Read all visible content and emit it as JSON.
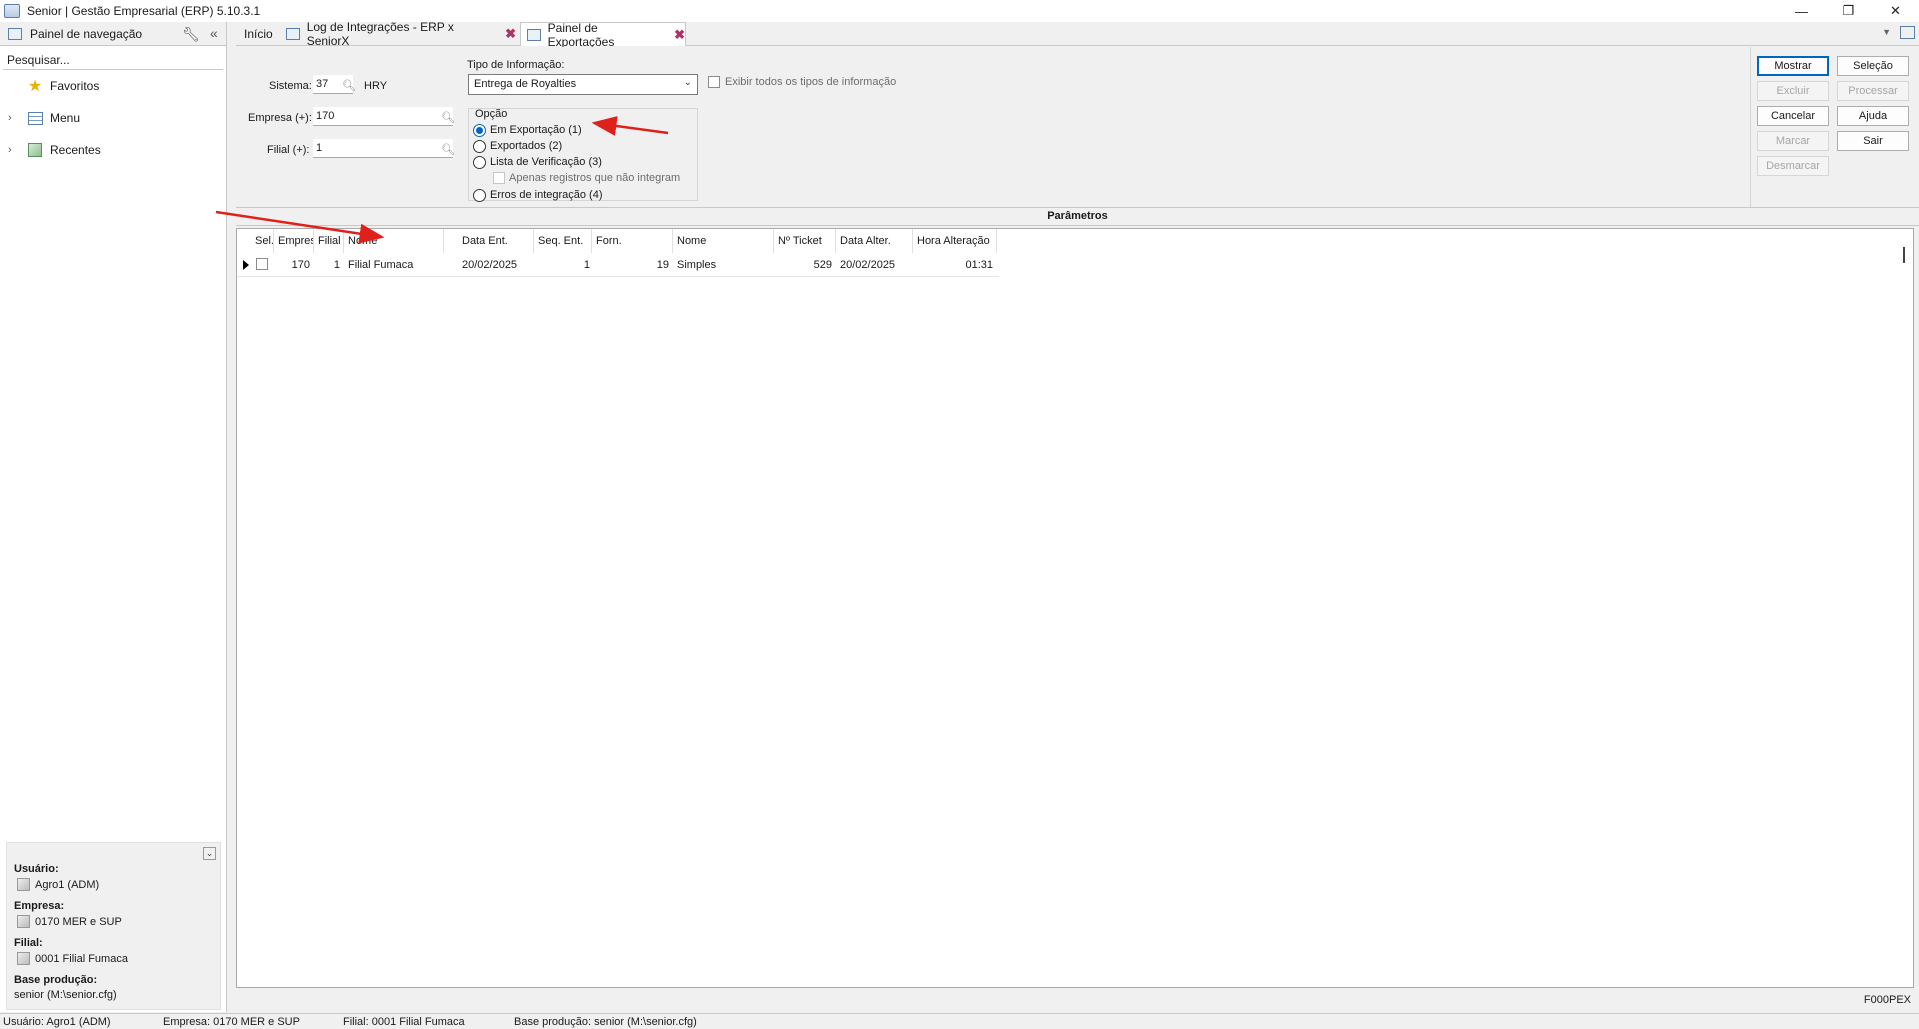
{
  "window": {
    "title": "Senior | Gestão Empresarial (ERP) 5.10.3.1",
    "minimize": "—",
    "maximize": "❐",
    "close": "✕"
  },
  "nav": {
    "title": "Painel de navegação",
    "search_placeholder": "Pesquisar...",
    "items": [
      {
        "label": "Favoritos",
        "icon": "star-icon"
      },
      {
        "label": "Menu",
        "icon": "menu-list-icon"
      },
      {
        "label": "Recentes",
        "icon": "recent-icon"
      }
    ],
    "user_label": "Usuário:",
    "user_value": "Agro1 (ADM)",
    "company_label": "Empresa:",
    "company_value": "0170 MER e SUP",
    "branch_label": "Filial:",
    "branch_value": "0001 Filial Fumaca",
    "base_label": "Base produção:",
    "base_value": "senior (M:\\senior.cfg)"
  },
  "tabs": [
    {
      "label": "Início"
    },
    {
      "label": "Log de Integrações - ERP x SeniorX"
    },
    {
      "label": "Painel de Exportações"
    }
  ],
  "form": {
    "sistema_label": "Sistema:",
    "sistema_value": "37",
    "sistema_desc": "HRY",
    "empresa_label": "Empresa (+):",
    "empresa_value": "170",
    "filial_label": "Filial (+):",
    "filial_value": "1",
    "tipo_label": "Tipo de Informação:",
    "tipo_value": "Entrega de Royalties",
    "exibir_label": "Exibir todos os tipos de informação",
    "opcao_label": "Opção",
    "options": [
      {
        "label": "Em Exportação (1)",
        "checked": true
      },
      {
        "label": "Exportados (2)",
        "checked": false
      },
      {
        "label": "Lista de Verificação (3)",
        "checked": false
      },
      {
        "label": "Erros de integração (4)",
        "checked": false
      }
    ],
    "apenas_label": "Apenas registros que não integram"
  },
  "buttons": {
    "mostrar": "Mostrar",
    "selecao": "Seleção",
    "excluir": "Excluir",
    "processar": "Processar",
    "cancelar": "Cancelar",
    "ajuda": "Ajuda",
    "marcar": "Marcar",
    "sair": "Sair",
    "desmarcar": "Desmarcar"
  },
  "parametros": "Parâmetros",
  "grid": {
    "columns": [
      "Sel.",
      "Empresa",
      "Filial",
      "Nome",
      "Data Ent.",
      "Seq. Ent.",
      "Forn.",
      "Nome",
      "Nº Ticket",
      "Data Alter.",
      "Hora Alteração"
    ],
    "rows": [
      [
        "",
        "170",
        "1",
        "Filial Fumaca",
        "20/02/2025",
        "1",
        "19",
        "Simples",
        "529",
        "20/02/2025",
        "01:31"
      ]
    ]
  },
  "screen_code": "F000PEX",
  "status": {
    "user": "Usuário: Agro1 (ADM)",
    "company": "Empresa: 0170 MER e SUP",
    "branch": "Filial: 0001 Filial Fumaca",
    "base": "Base produção: senior (M:\\senior.cfg)"
  },
  "colors": {
    "accent": "#0067c0",
    "annotation": "#e0201a"
  }
}
